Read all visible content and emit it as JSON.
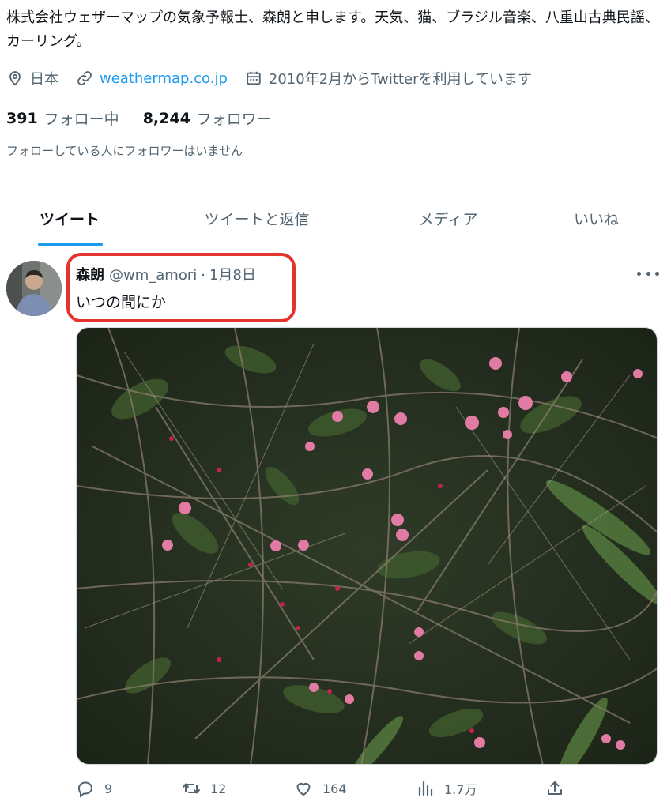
{
  "profile": {
    "bio": "株式会社ウェザーマップの気象予報士、森朗と申します。天気、猫、ブラジル音楽、八重山古典民謡、カーリング。",
    "location": "日本",
    "website": "weathermap.co.jp",
    "joined": "2010年2月からTwitterを利用しています",
    "following_count": "391",
    "following_label": "フォロー中",
    "followers_count": "8,244",
    "followers_label": "フォロワー",
    "no_known_followers": "フォローしている人にフォロワーはいません"
  },
  "tabs": [
    {
      "label": "ツイート",
      "active": true
    },
    {
      "label": "ツイートと返信",
      "active": false
    },
    {
      "label": "メディア",
      "active": false
    },
    {
      "label": "いいね",
      "active": false
    }
  ],
  "tweet": {
    "author": "森朗",
    "handle": "@wm_amori",
    "separator": "·",
    "date": "1月8日",
    "text": "いつの間にか",
    "replies": "9",
    "retweets": "12",
    "likes": "164",
    "views": "1.7万"
  },
  "icons": {
    "location": "location-pin-icon",
    "link": "link-icon",
    "calendar": "calendar-icon",
    "reply": "reply-icon",
    "retweet": "retweet-icon",
    "like": "heart-icon",
    "views": "analytics-icon",
    "share": "share-icon",
    "more": "more-dots-icon"
  },
  "colors": {
    "accent": "#1d9bf0",
    "text": "#0f1419",
    "secondary": "#536471",
    "annotation": "#e3342f"
  }
}
